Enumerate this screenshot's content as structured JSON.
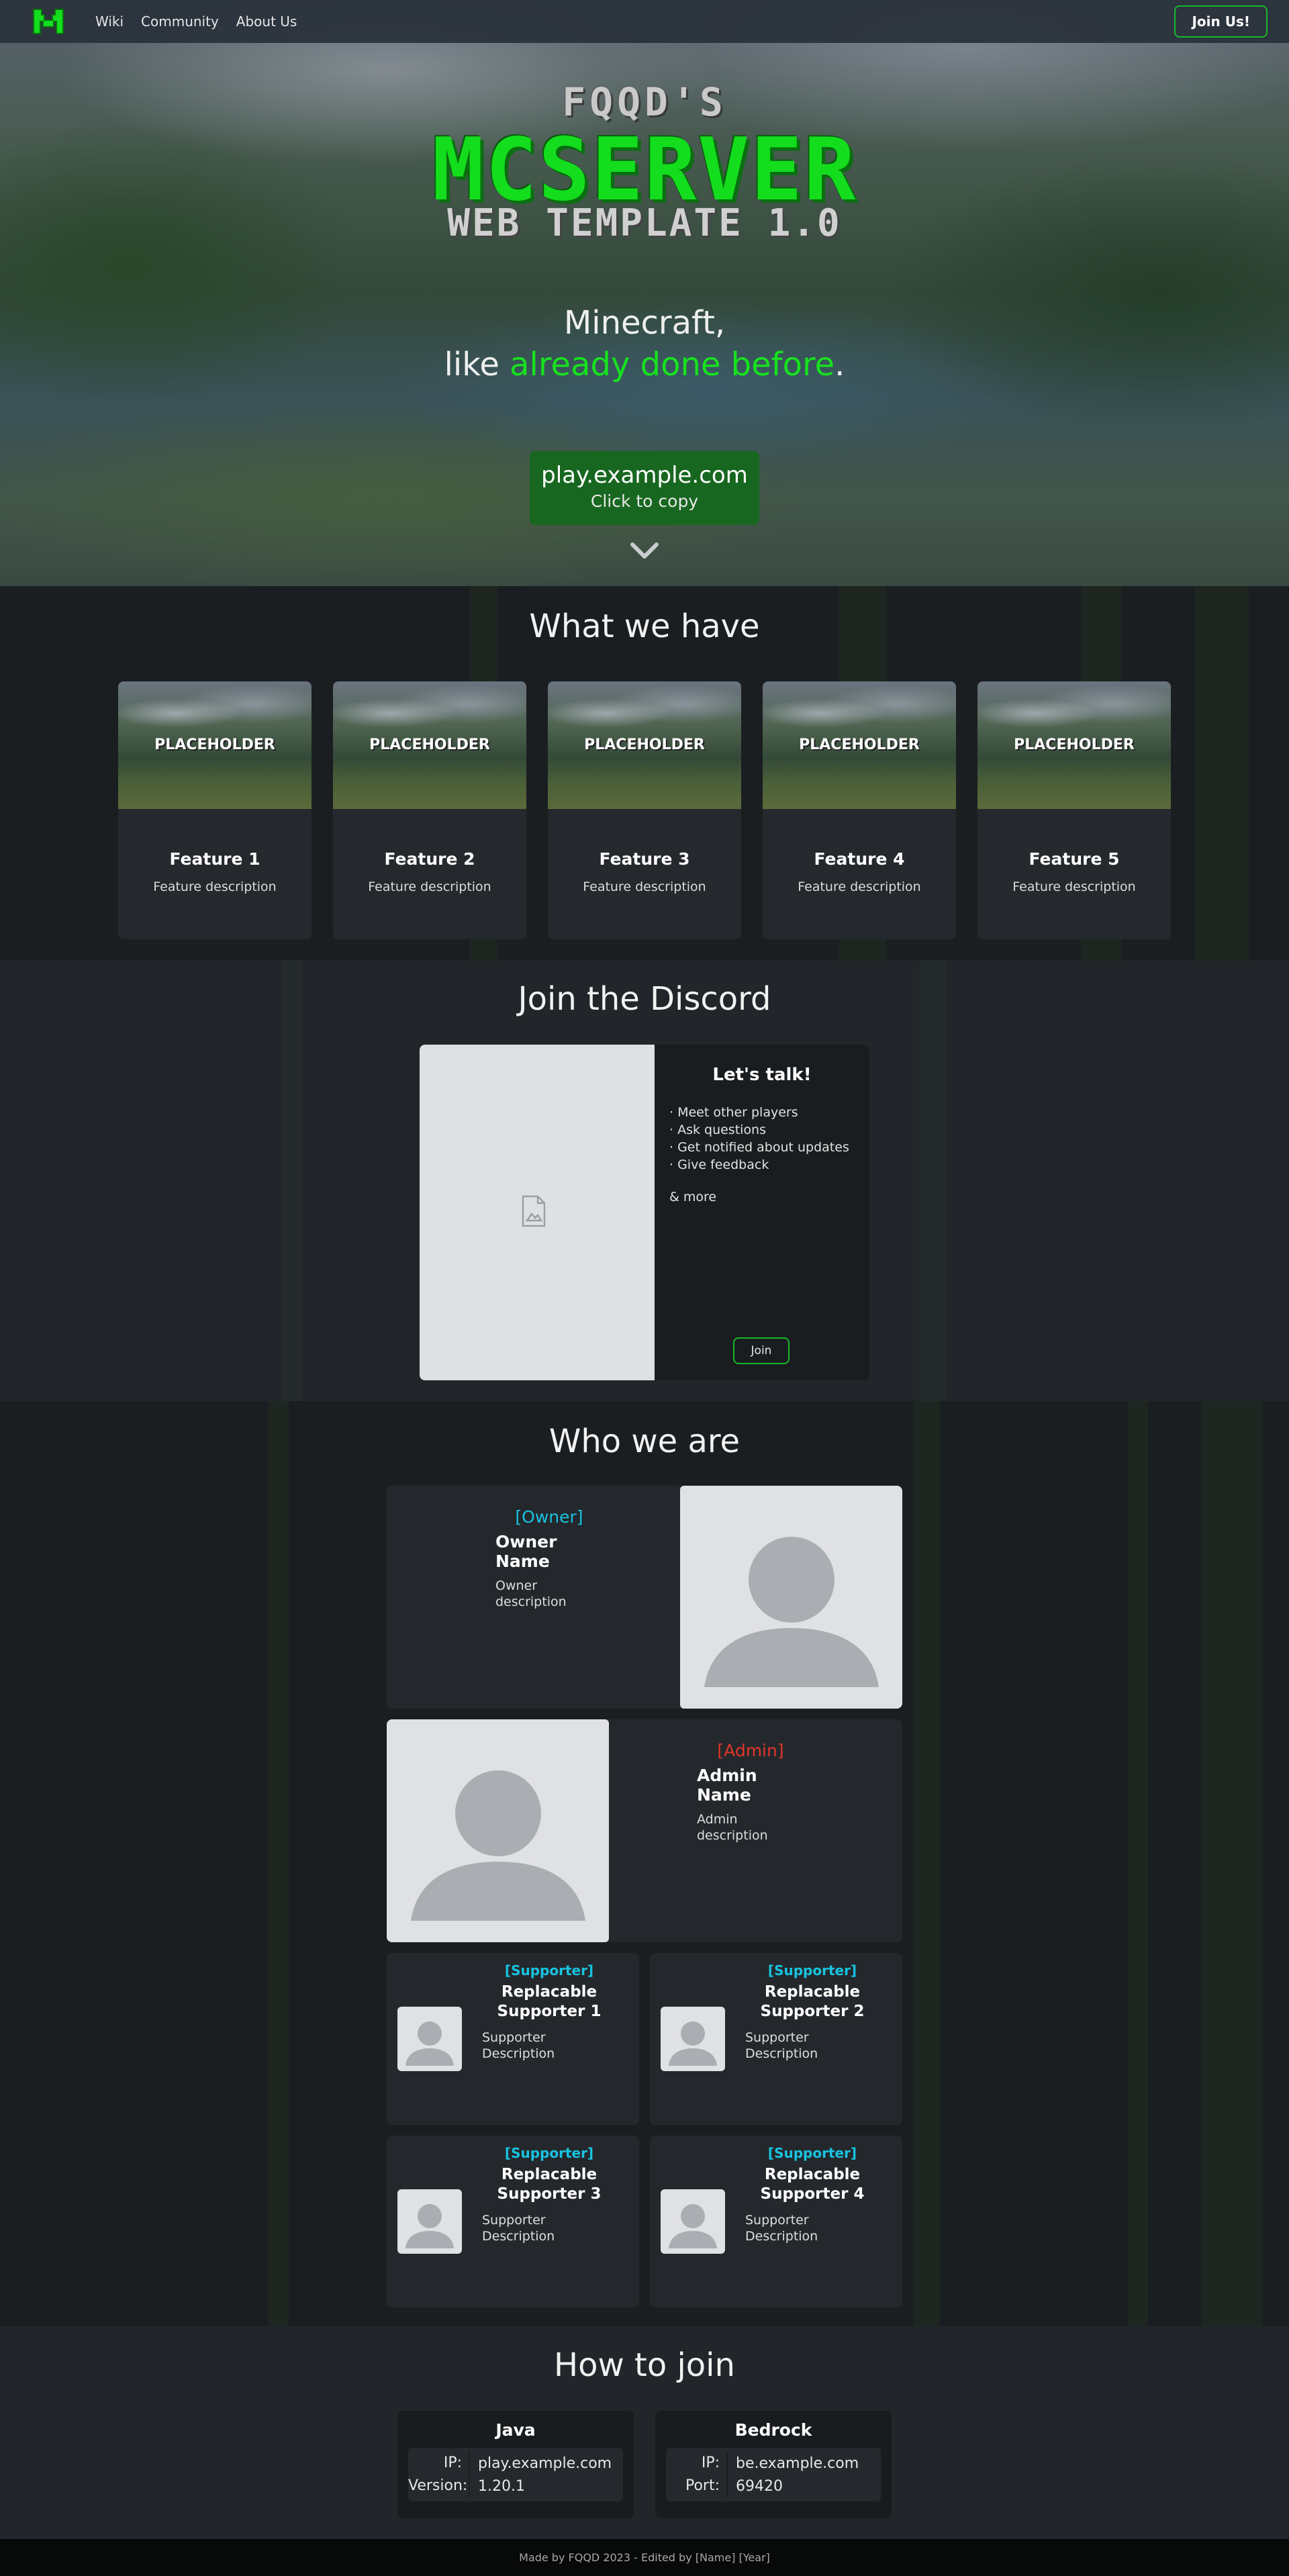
{
  "nav": {
    "links": [
      "Wiki",
      "Community",
      "About Us"
    ],
    "join_label": "Join Us!"
  },
  "hero": {
    "pre_title": "FQQD'S",
    "title": "MCSERVER",
    "sub_title": "WEB TEMPLATE 1.0",
    "tagline_line1": "Minecraft,",
    "tagline_pre": "like ",
    "tagline_highlight": "already done before",
    "tagline_post": ".",
    "server_ip": "play.example.com",
    "copy_hint": "Click to copy"
  },
  "features": {
    "title": "What we have",
    "items": [
      {
        "image_label": "PLACEHOLDER",
        "name": "Feature 1",
        "desc": "Feature description"
      },
      {
        "image_label": "PLACEHOLDER",
        "name": "Feature 2",
        "desc": "Feature description"
      },
      {
        "image_label": "PLACEHOLDER",
        "name": "Feature 3",
        "desc": "Feature description"
      },
      {
        "image_label": "PLACEHOLDER",
        "name": "Feature 4",
        "desc": "Feature description"
      },
      {
        "image_label": "PLACEHOLDER",
        "name": "Feature 5",
        "desc": "Feature description"
      }
    ]
  },
  "discord": {
    "title": "Join the Discord",
    "heading": "Let's talk!",
    "list": [
      "· Meet other players",
      "· Ask questions",
      "· Get notified about updates",
      "· Give feedback"
    ],
    "more": "& more",
    "join_label": "Join"
  },
  "team": {
    "title": "Who we are",
    "owner": {
      "role": "[Owner]",
      "name": "Owner Name",
      "desc_line1": "Owner",
      "desc_line2": "description"
    },
    "admin": {
      "role": "[Admin]",
      "name": "Admin Name",
      "desc_line1": "Admin",
      "desc_line2": "description"
    },
    "supporters": [
      {
        "role": "[Supporter]",
        "name_line1": "Replacable",
        "name_line2": "Supporter 1",
        "desc_line1": "Supporter",
        "desc_line2": "Description"
      },
      {
        "role": "[Supporter]",
        "name_line1": "Replacable",
        "name_line2": "Supporter 2",
        "desc_line1": "Supporter",
        "desc_line2": "Description"
      },
      {
        "role": "[Supporter]",
        "name_line1": "Replacable",
        "name_line2": "Supporter 3",
        "desc_line1": "Supporter",
        "desc_line2": "Description"
      },
      {
        "role": "[Supporter]",
        "name_line1": "Replacable",
        "name_line2": "Supporter 4",
        "desc_line1": "Supporter",
        "desc_line2": "Description"
      }
    ]
  },
  "how_to_join": {
    "title": "How to join",
    "java": {
      "title": "Java",
      "k1": "IP:",
      "v1": "play.example.com",
      "k2": "Version:",
      "v2": "1.20.1"
    },
    "bedrock": {
      "title": "Bedrock",
      "k1": "IP:",
      "v1": "be.example.com",
      "k2": "Port:",
      "v2": "69420"
    }
  },
  "footer": {
    "text": "Made by FQQD 2023 - Edited by [Name] [Year]"
  }
}
